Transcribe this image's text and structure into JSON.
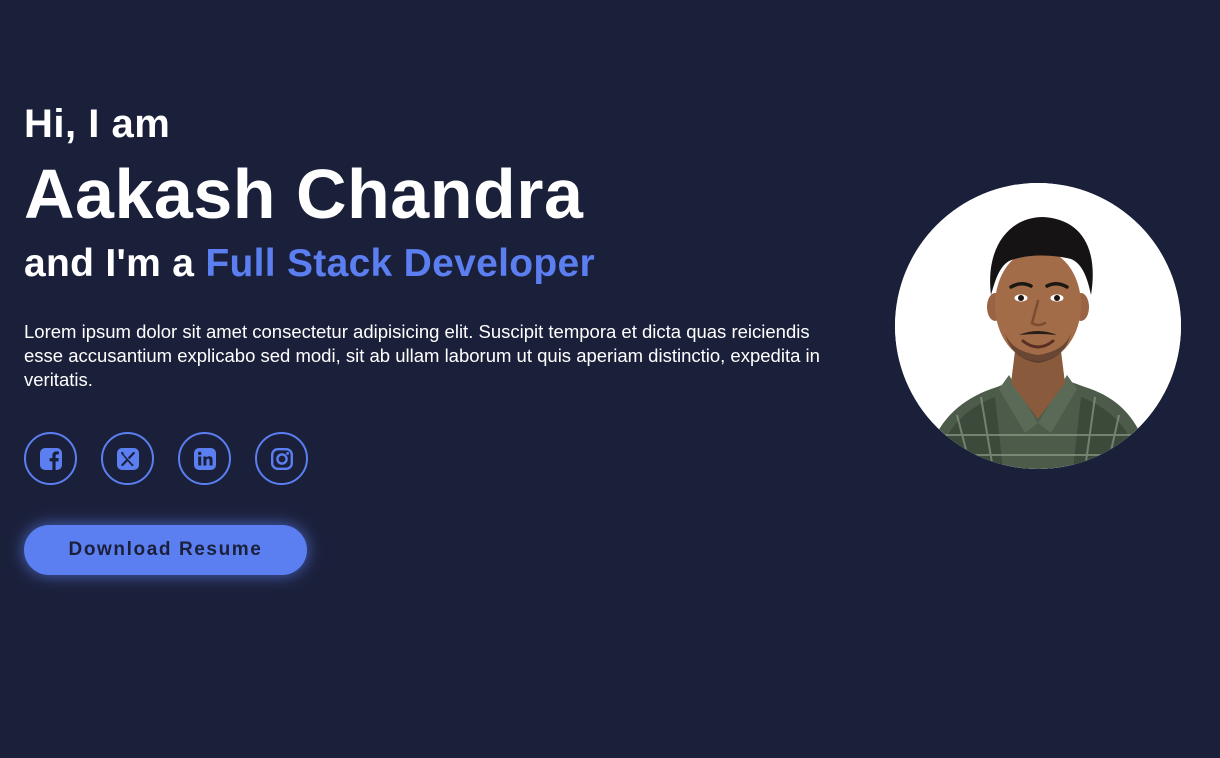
{
  "hero": {
    "greeting": "Hi, I am",
    "name": "Aakash Chandra",
    "role_prefix": "and I'm a ",
    "role": "Full Stack Developer",
    "bio": "Lorem ipsum dolor sit amet consectetur adipisicing elit. Suscipit tempora et dicta quas reiciendis esse accusantium explicabo sed modi, sit ab ullam laborum ut quis aperiam distinctio, expedita in veritatis."
  },
  "socials": [
    {
      "icon": "facebook-icon"
    },
    {
      "icon": "x-twitter-icon"
    },
    {
      "icon": "linkedin-icon"
    },
    {
      "icon": "instagram-icon"
    }
  ],
  "cta": {
    "label": "Download Resume"
  },
  "theme": {
    "background": "#1b203a",
    "accent": "#5b7ef0",
    "text": "#ffffff"
  }
}
